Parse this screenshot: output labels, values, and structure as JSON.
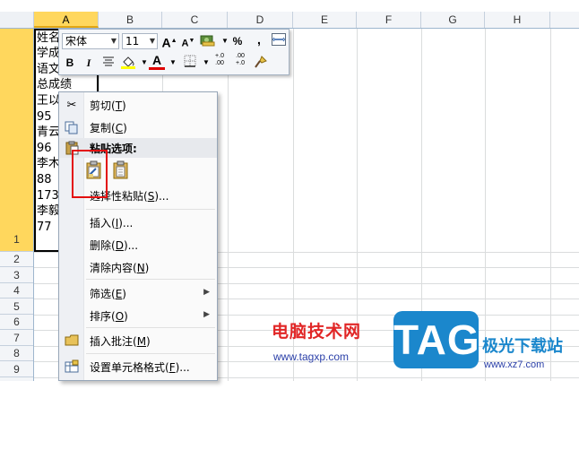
{
  "columns": [
    "A",
    "B",
    "C",
    "D",
    "E",
    "F",
    "G",
    "H"
  ],
  "rows": [
    "1",
    "2",
    "3",
    "4",
    "5",
    "6",
    "7",
    "8",
    "9"
  ],
  "cell_a1_lines": [
    "姓名",
    "学成",
    "语文",
    "总成绩",
    "王以",
    "95",
    "青云",
    "96",
    "李木",
    "88",
    "173",
    "李毅",
    "77"
  ],
  "mini_toolbar": {
    "font_name": "宋体",
    "font_size": "11",
    "grow_font": "A",
    "shrink_font": "A",
    "percent": "%",
    "comma": ",",
    "bold": "B",
    "italic": "I",
    "font_color_letter": "A",
    "inc_decimal": "+.0\n.00",
    "dec_decimal": ".00\n+.0"
  },
  "context_menu": {
    "cut": {
      "label": "剪切(",
      "key": "T",
      "end": ")"
    },
    "copy": {
      "label": "复制(",
      "key": "C",
      "end": ")"
    },
    "paste_options": {
      "label": "粘贴选项:"
    },
    "paste_special": {
      "label": "选择性粘贴(",
      "key": "S",
      "end": ")..."
    },
    "insert": {
      "label": "插入(",
      "key": "I",
      "end": ")..."
    },
    "delete": {
      "label": "删除(",
      "key": "D",
      "end": ")..."
    },
    "clear": {
      "label": "清除内容(",
      "key": "N",
      "end": ")"
    },
    "filter": {
      "label": "筛选(",
      "key": "E",
      "end": ")"
    },
    "sort": {
      "label": "排序(",
      "key": "O",
      "end": ")"
    },
    "insert_comment": {
      "label": "插入批注(",
      "key": "M",
      "end": ")"
    },
    "format_cells": {
      "label": "设置单元格格式(",
      "key": "F",
      "end": ")..."
    }
  },
  "watermark": {
    "site_name": "电脑技术网",
    "site_url": "www.tagxp.com",
    "tag_logo": "TAG",
    "brand": "极光下载站",
    "brand_url": "www.xz7.com"
  },
  "colors": {
    "selection_header": "#ffd75d",
    "highlight_box": "#e30f0f",
    "tag_blue": "#1b87cc",
    "watermark_red": "#e12626"
  }
}
